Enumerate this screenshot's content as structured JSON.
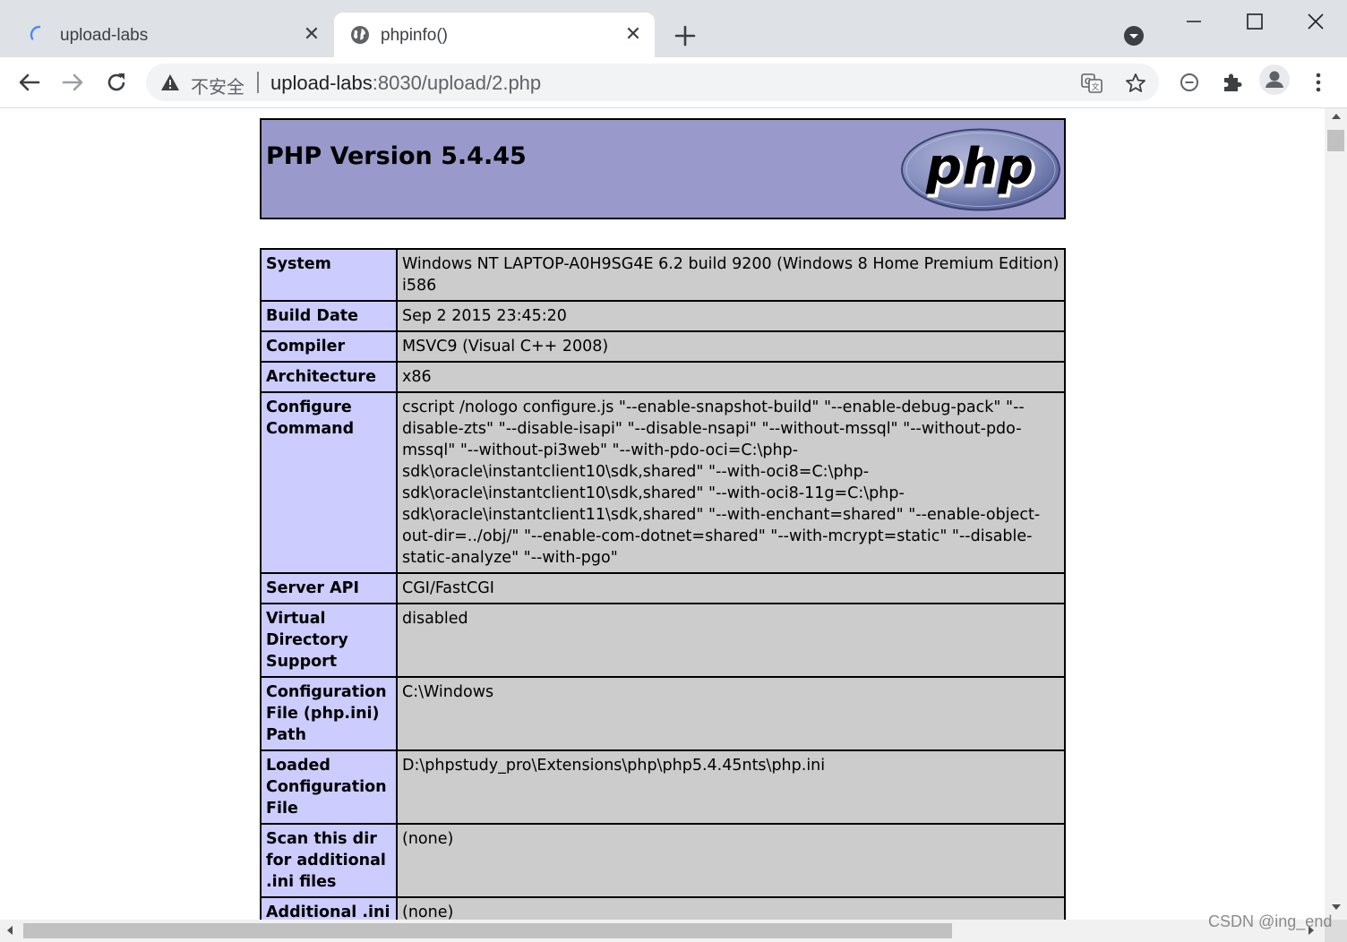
{
  "tabs": [
    {
      "title": "upload-labs",
      "loading": true
    },
    {
      "title": "phpinfo()",
      "active": true
    }
  ],
  "toolbar": {
    "security_label": "不安全",
    "url_host": "upload-labs",
    "url_rest": ":8030/upload/2.php"
  },
  "icons": {
    "back": "arrow-left-icon",
    "forward": "arrow-right-icon",
    "reload": "reload-icon",
    "warning": "warning-triangle-icon",
    "translate": "translate-icon",
    "bookmark": "star-icon",
    "media": "media-control-icon",
    "extensions": "puzzle-piece-icon",
    "profile": "person-icon",
    "menu": "three-dots-vertical-icon"
  },
  "page": {
    "version_title": "PHP Version 5.4.45",
    "logo_text": "php",
    "colors": {
      "header": "#9999cc",
      "label_cell": "#ccccff",
      "value_cell": "#cccccc"
    },
    "rows": [
      {
        "label": "System",
        "value": "Windows NT LAPTOP-A0H9SG4E 6.2 build 9200 (Windows 8 Home Premium Edition) i586"
      },
      {
        "label": "Build Date",
        "value": "Sep 2 2015 23:45:20"
      },
      {
        "label": "Compiler",
        "value": "MSVC9 (Visual C++ 2008)"
      },
      {
        "label": "Architecture",
        "value": "x86"
      },
      {
        "label": "Configure Command",
        "value": "cscript /nologo configure.js \"--enable-snapshot-build\" \"--enable-debug-pack\" \"--disable-zts\" \"--disable-isapi\" \"--disable-nsapi\" \"--without-mssql\" \"--without-pdo-mssql\" \"--without-pi3web\" \"--with-pdo-oci=C:\\php-sdk\\oracle\\instantclient10\\sdk,shared\" \"--with-oci8=C:\\php-sdk\\oracle\\instantclient10\\sdk,shared\" \"--with-oci8-11g=C:\\php-sdk\\oracle\\instantclient11\\sdk,shared\" \"--with-enchant=shared\" \"--enable-object-out-dir=../obj/\" \"--enable-com-dotnet=shared\" \"--with-mcrypt=static\" \"--disable-static-analyze\" \"--with-pgo\""
      },
      {
        "label": "Server API",
        "value": "CGI/FastCGI"
      },
      {
        "label": "Virtual Directory Support",
        "value": "disabled"
      },
      {
        "label": "Configuration File (php.ini) Path",
        "value": "C:\\Windows"
      },
      {
        "label": "Loaded Configuration File",
        "value": "D:\\phpstudy_pro\\Extensions\\php\\php5.4.45nts\\php.ini"
      },
      {
        "label": "Scan this dir for additional .ini files",
        "value": "(none)"
      },
      {
        "label": "Additional .ini",
        "value": "(none)"
      }
    ]
  },
  "watermark": "CSDN @ing_end"
}
